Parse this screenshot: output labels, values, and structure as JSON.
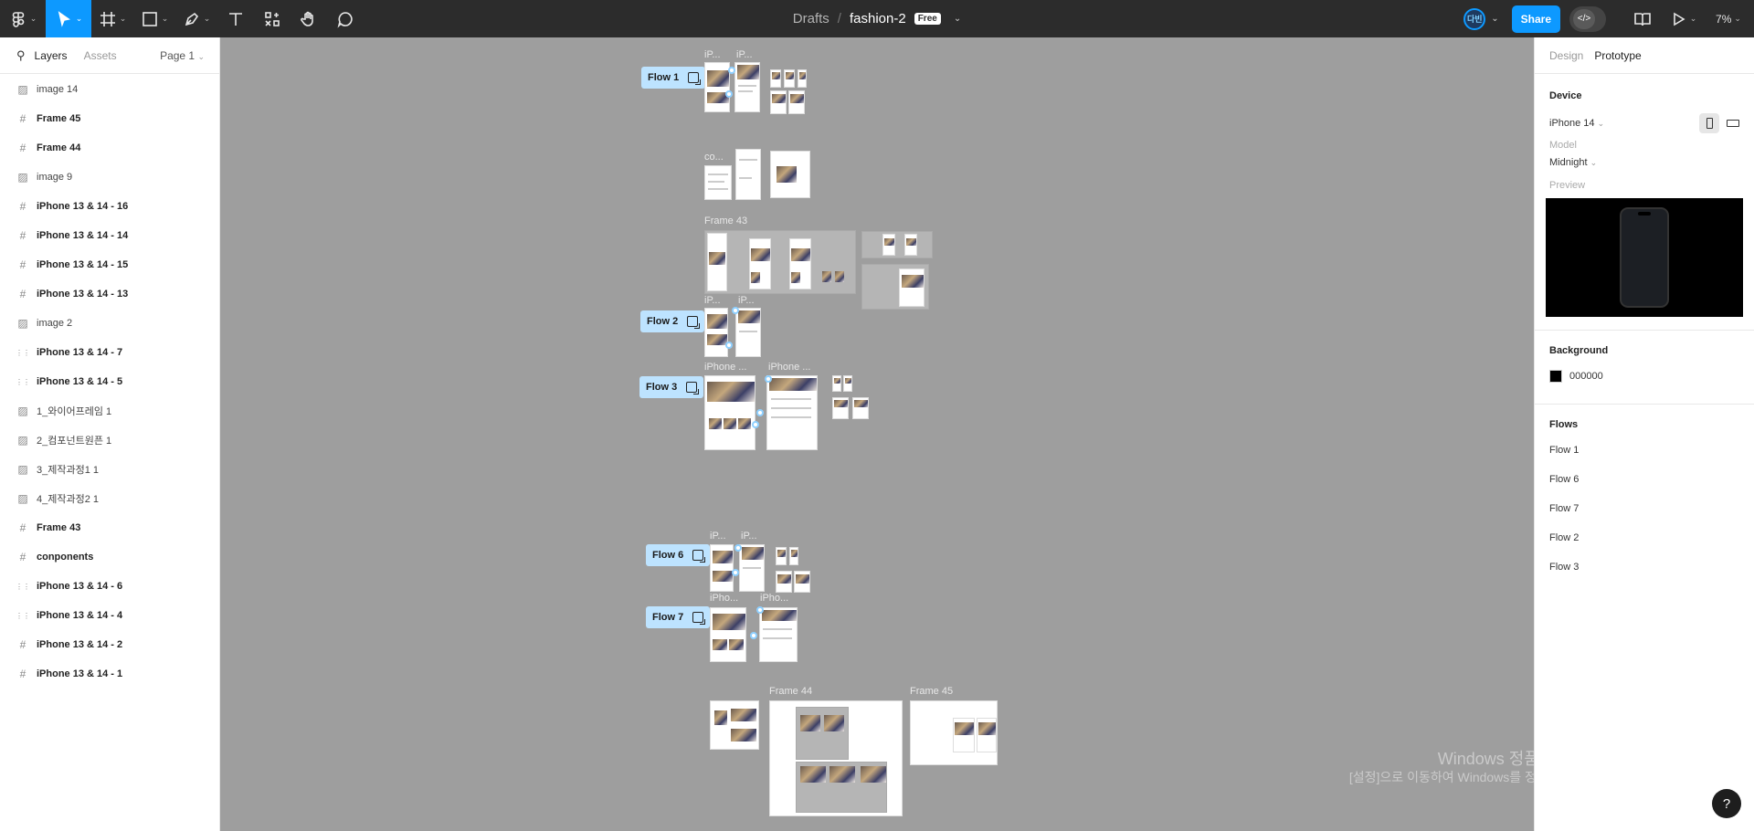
{
  "toolbar": {
    "tools": [
      "figma-menu",
      "move",
      "frame",
      "shape",
      "pen",
      "text",
      "resources",
      "hand",
      "comment"
    ],
    "breadcrumb": "Drafts",
    "filename": "fashion-2",
    "plan_badge": "Free",
    "avatar_text": "다빈",
    "share_label": "Share",
    "zoom": "7%"
  },
  "left_panel": {
    "tab_layers": "Layers",
    "tab_assets": "Assets",
    "page": "Page 1",
    "layers": [
      {
        "name": "image 14",
        "icon": "image-icon",
        "bold": false
      },
      {
        "name": "Frame 45",
        "icon": "frame-icon",
        "bold": true
      },
      {
        "name": "Frame 44",
        "icon": "frame-icon",
        "bold": true
      },
      {
        "name": "image 9",
        "icon": "image-icon",
        "bold": false
      },
      {
        "name": "iPhone 13 & 14 - 16",
        "icon": "frame-icon",
        "bold": true
      },
      {
        "name": "iPhone 13 & 14 - 14",
        "icon": "frame-icon",
        "bold": true
      },
      {
        "name": "iPhone 13 & 14 - 15",
        "icon": "frame-icon",
        "bold": true
      },
      {
        "name": "iPhone 13 & 14 - 13",
        "icon": "frame-icon",
        "bold": true
      },
      {
        "name": "image 2",
        "icon": "image-icon",
        "bold": false
      },
      {
        "name": "iPhone 13 & 14 - 7",
        "icon": "autolayout-icon",
        "bold": true
      },
      {
        "name": "iPhone 13 & 14 - 5",
        "icon": "autolayout-icon",
        "bold": true
      },
      {
        "name": "1_와이어프레임 1",
        "icon": "image-icon",
        "bold": false
      },
      {
        "name": "2_컴포넌트원픈 1",
        "icon": "image-icon",
        "bold": false
      },
      {
        "name": "3_제작과정1 1",
        "icon": "image-icon",
        "bold": false
      },
      {
        "name": "4_제작과정2 1",
        "icon": "image-icon",
        "bold": false
      },
      {
        "name": "Frame 43",
        "icon": "frame-icon",
        "bold": true
      },
      {
        "name": "conponents",
        "icon": "frame-icon",
        "bold": true
      },
      {
        "name": "iPhone 13 & 14 - 6",
        "icon": "autolayout-icon",
        "bold": true
      },
      {
        "name": "iPhone 13 & 14 - 4",
        "icon": "autolayout-icon",
        "bold": true
      },
      {
        "name": "iPhone 13 & 14 - 2",
        "icon": "frame-icon",
        "bold": true
      },
      {
        "name": "iPhone 13 & 14 - 1",
        "icon": "frame-icon",
        "bold": true
      }
    ]
  },
  "right_panel": {
    "tab_design": "Design",
    "tab_prototype": "Prototype",
    "device_title": "Device",
    "device_value": "iPhone 14",
    "model_label": "Model",
    "model_value": "Midnight",
    "preview_label": "Preview",
    "background_title": "Background",
    "background_value": "000000",
    "flows_title": "Flows",
    "flows": [
      "Flow 1",
      "Flow 6",
      "Flow 7",
      "Flow 2",
      "Flow 3"
    ]
  },
  "canvas": {
    "labels": {
      "l1": "iP...",
      "l2": "iP...",
      "co": "co...",
      "frame43": "Frame 43",
      "l3": "iP...",
      "l4": "iP...",
      "l5": "iPhone ...",
      "l6": "iPhone ...",
      "l7": "iP...",
      "l8": "iP...",
      "l9": "iPho...",
      "l10": "iPho...",
      "frame44": "Frame 44",
      "frame45": "Frame 45"
    },
    "flow_chips": {
      "flow1": "Flow 1",
      "flow2": "Flow 2",
      "flow3": "Flow 3",
      "flow6": "Flow 6",
      "flow7": "Flow 7"
    }
  },
  "watermark": {
    "line1": "Windows 정품 인증",
    "line2": "[설정]으로 이동하여 Windows를 정품 인증합니다."
  },
  "help_label": "?",
  "colors": {
    "toolbar_bg": "#2c2c2c",
    "accent": "#0d99ff",
    "canvas_bg": "#9e9e9e",
    "flow_chip": "#bde3ff"
  }
}
